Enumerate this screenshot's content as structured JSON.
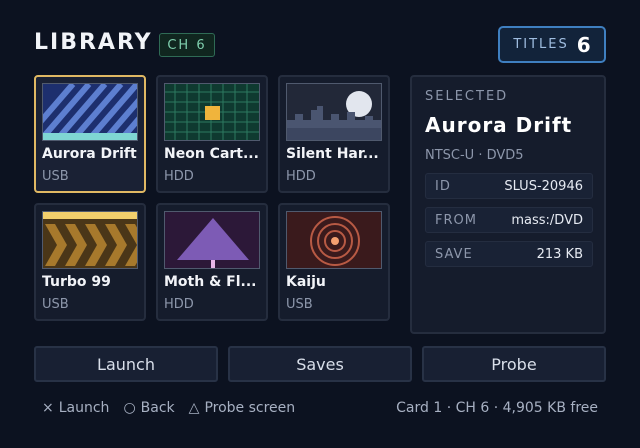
{
  "header": {
    "title": "LIBRARY",
    "channel_badge": "CH 6",
    "titles_label": "TITLES",
    "titles_count": "6"
  },
  "games": [
    {
      "name": "Aurora Drift",
      "source": "USB",
      "thumb_icon": "diagonal-stripes-art",
      "selected": true
    },
    {
      "name": "Neon Cart...",
      "source": "HDD",
      "thumb_icon": "green-grid-art"
    },
    {
      "name": "Silent Har...",
      "source": "HDD",
      "thumb_icon": "night-city-moon-art"
    },
    {
      "name": "Turbo 99",
      "source": "USB",
      "thumb_icon": "chevron-arrows-art"
    },
    {
      "name": "Moth & Fl...",
      "source": "HDD",
      "thumb_icon": "purple-triangle-art"
    },
    {
      "name": "Kaiju",
      "source": "USB",
      "thumb_icon": "concentric-rings-art"
    }
  ],
  "detail": {
    "heading": "SELECTED",
    "title": "Aurora Drift",
    "meta": "NTSC-U · DVD5",
    "fields": [
      {
        "key": "ID",
        "value": "SLUS-20946"
      },
      {
        "key": "FROM",
        "value": "mass:/DVD"
      },
      {
        "key": "SAVE",
        "value": "213 KB"
      }
    ]
  },
  "actions": {
    "launch": "Launch",
    "saves": "Saves",
    "probe": "Probe"
  },
  "hints": [
    {
      "symbol": "×",
      "label": "Launch"
    },
    {
      "symbol": "○",
      "label": "Back"
    },
    {
      "symbol": "△",
      "label": "Probe screen"
    }
  ],
  "footer_status": "Card 1 · CH 6 · 4,905 KB free",
  "colors": {
    "background": "#0c1220",
    "selected_border": "#e0b863",
    "badge_green": "#7fcfad",
    "accent_blue": "#3f7fc0"
  }
}
